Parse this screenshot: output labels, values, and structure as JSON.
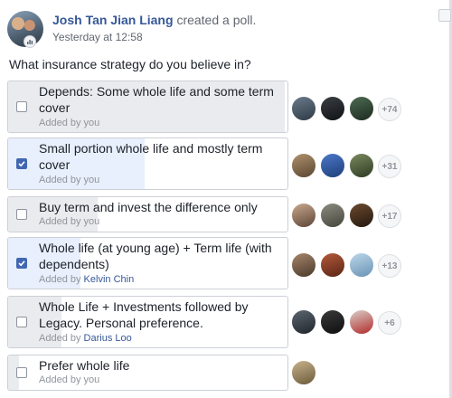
{
  "post": {
    "author": "Josh Tan Jian Liang",
    "action": "created a poll.",
    "timestamp": "Yesterday at 12:58"
  },
  "poll": {
    "question": "What insurance strategy do you believe in?",
    "options": [
      {
        "text": "Depends: Some whole life and some term cover",
        "added_by_prefix": "Added by you",
        "added_by_name": "",
        "checked": false,
        "vote_fill_fraction": 0.99,
        "voter_avatars": [
          "voter-avatar",
          "voter-avatar",
          "voter-avatar"
        ],
        "more_count": "+74"
      },
      {
        "text": "Small portion whole life and mostly term cover",
        "added_by_prefix": "Added by you",
        "added_by_name": "",
        "checked": true,
        "vote_fill_fraction": 0.49,
        "voter_avatars": [
          "voter-avatar",
          "voter-avatar",
          "voter-avatar"
        ],
        "more_count": "+31"
      },
      {
        "text": "Buy term and invest the difference only",
        "added_by_prefix": "Added by you",
        "added_by_name": "",
        "checked": false,
        "vote_fill_fraction": 0.32,
        "voter_avatars": [
          "voter-avatar",
          "voter-avatar",
          "voter-avatar"
        ],
        "more_count": "+17"
      },
      {
        "text": "Whole life (at young age) + Term life (with dependents)",
        "added_by_prefix": "Added by",
        "added_by_name": "Kelvin Chin",
        "checked": true,
        "vote_fill_fraction": 0.26,
        "voter_avatars": [
          "voter-avatar",
          "voter-avatar",
          "voter-avatar"
        ],
        "more_count": "+13"
      },
      {
        "text": "Whole Life + Investments followed by Legacy. Personal preference.",
        "added_by_prefix": "Added by",
        "added_by_name": "Darius Loo",
        "checked": false,
        "vote_fill_fraction": 0.19,
        "voter_avatars": [
          "voter-avatar",
          "voter-avatar",
          "voter-avatar"
        ],
        "more_count": "+6"
      },
      {
        "text": "Prefer whole life",
        "added_by_prefix": "Added by you",
        "added_by_name": "",
        "checked": false,
        "vote_fill_fraction": 0.04,
        "voter_avatars": [
          "voter-avatar"
        ],
        "more_count": ""
      }
    ]
  },
  "colors": {
    "link": "#365899",
    "check": "#4267b2",
    "voted_fill": "#e7f0fc",
    "fill": "#e9ebee"
  }
}
